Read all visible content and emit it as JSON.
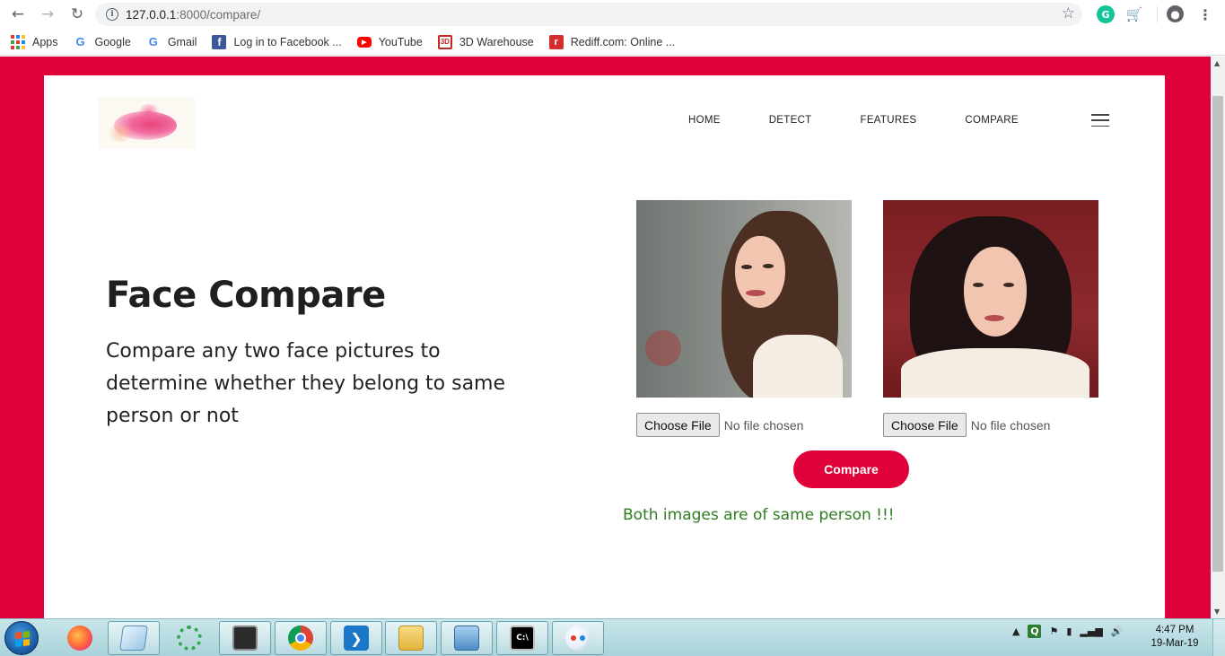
{
  "browser": {
    "url_host": "127.0.0.1",
    "url_rest": ":8000/compare/",
    "bookmarks": [
      {
        "label": "Apps",
        "icon": "apps-icon"
      },
      {
        "label": "Google",
        "icon": "google-icon"
      },
      {
        "label": "Gmail",
        "icon": "google-icon"
      },
      {
        "label": "Log in to Facebook ...",
        "icon": "facebook-icon"
      },
      {
        "label": "YouTube",
        "icon": "youtube-icon"
      },
      {
        "label": "3D Warehouse",
        "icon": "warehouse-icon"
      },
      {
        "label": "Rediff.com: Online ...",
        "icon": "rediff-icon"
      }
    ]
  },
  "site": {
    "nav": [
      "HOME",
      "DETECT",
      "FEATURES",
      "COMPARE"
    ],
    "hero": {
      "title": "Face Compare",
      "subtitle": "Compare any two face pictures to determine whether they belong to same person or not"
    },
    "uploads": [
      {
        "button": "Choose File",
        "status": "No file chosen"
      },
      {
        "button": "Choose File",
        "status": "No file chosen"
      }
    ],
    "compare_label": "Compare",
    "result_text": "Both images are of same person !!!",
    "colors": {
      "accent": "#e0003a",
      "result": "#2e7d1f"
    }
  },
  "taskbar": {
    "apps": [
      "firefox-icon",
      "notepad-icon",
      "loading-ring-icon",
      "terminal-icon",
      "chrome-icon",
      "vscode-icon",
      "file-explorer-icon",
      "control-panel-icon",
      "cmd-icon",
      "paint-icon"
    ],
    "clock_time": "4:47 PM",
    "clock_date": "19-Mar-19"
  }
}
